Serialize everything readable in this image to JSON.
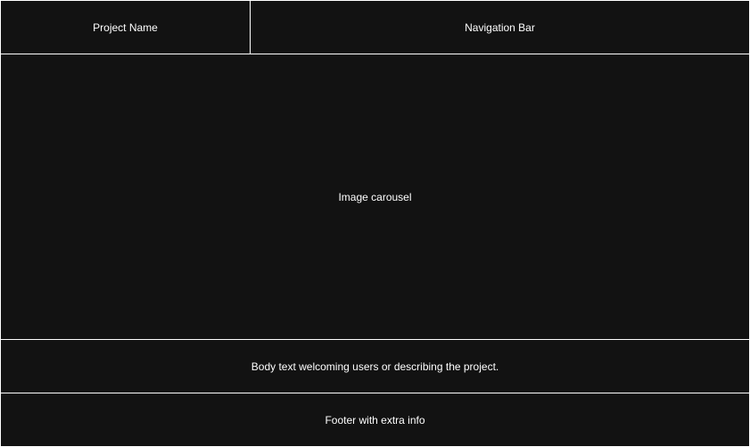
{
  "header": {
    "project_name": "Project Name",
    "navigation_label": "Navigation Bar"
  },
  "main": {
    "carousel_label": "Image carousel",
    "body_text": "Body text welcoming users or describing the project."
  },
  "footer": {
    "text": "Footer with extra info"
  },
  "colors": {
    "panel_background": "#121212",
    "divider": "#ffffff",
    "text": "#ffffff"
  }
}
